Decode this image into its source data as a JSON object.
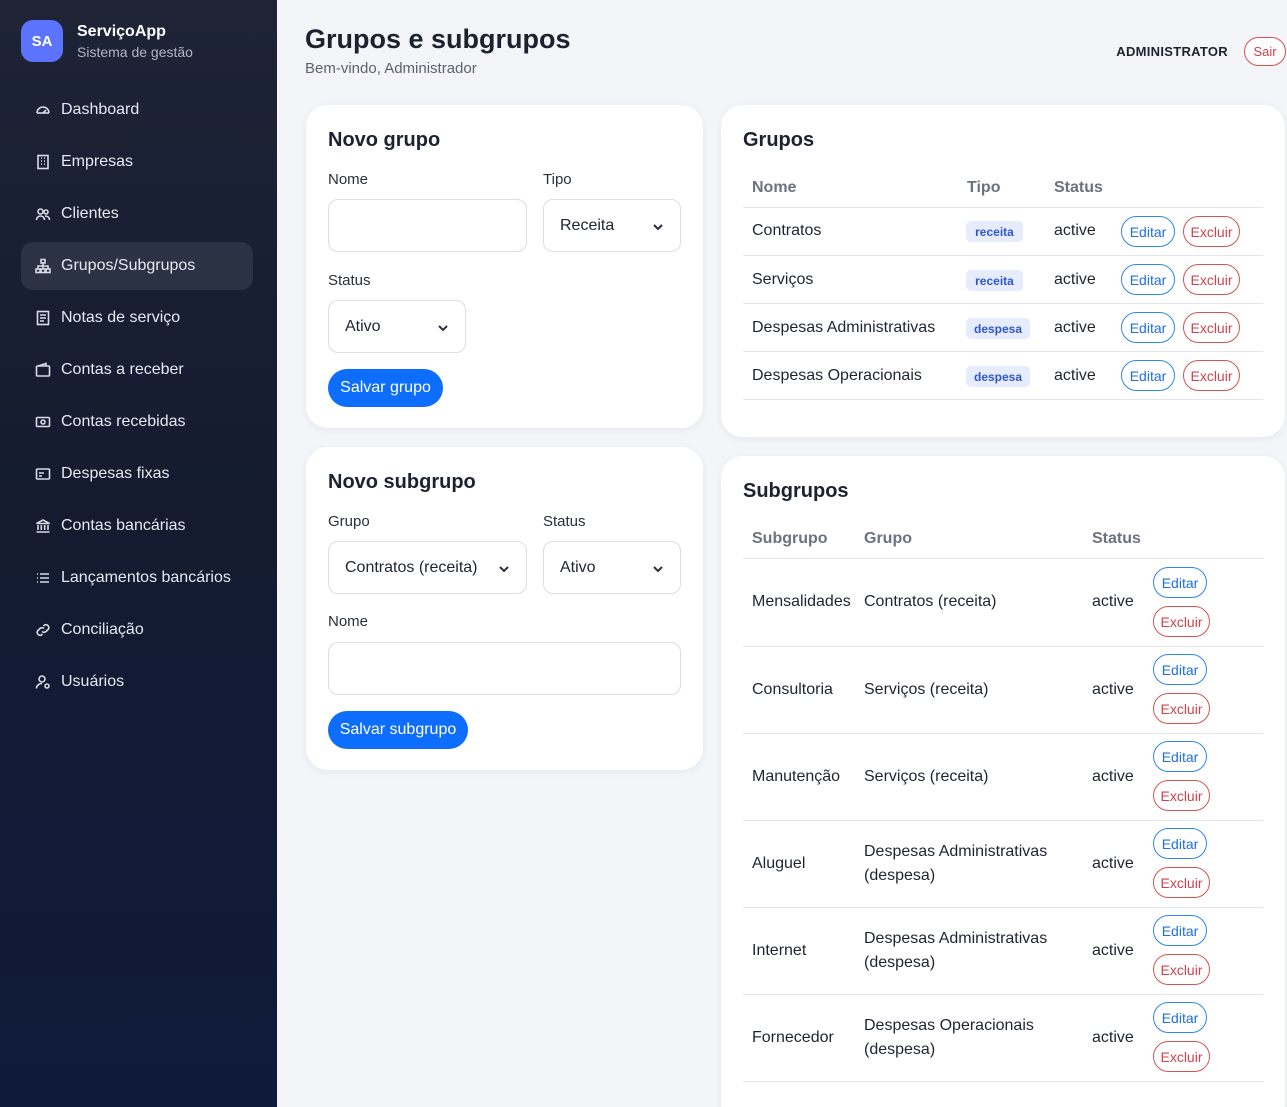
{
  "brand": {
    "initials": "SA",
    "name": "ServiçoApp",
    "subtitle": "Sistema de gestão"
  },
  "sidebar": {
    "items": [
      {
        "label": "Dashboard",
        "icon": "dashboard-icon"
      },
      {
        "label": "Empresas",
        "icon": "building-icon"
      },
      {
        "label": "Clientes",
        "icon": "users-icon"
      },
      {
        "label": "Grupos/Subgrupos",
        "icon": "hierarchy-icon",
        "active": true
      },
      {
        "label": "Notas de serviço",
        "icon": "document-icon"
      },
      {
        "label": "Contas a receber",
        "icon": "wallet-icon"
      },
      {
        "label": "Contas recebidas",
        "icon": "cash-icon"
      },
      {
        "label": "Despesas fixas",
        "icon": "card-icon"
      },
      {
        "label": "Contas bancárias",
        "icon": "bank-icon"
      },
      {
        "label": "Lançamentos bancários",
        "icon": "list-icon"
      },
      {
        "label": "Conciliação",
        "icon": "link-icon"
      },
      {
        "label": "Usuários",
        "icon": "user-gear-icon"
      }
    ]
  },
  "header": {
    "title": "Grupos e subgrupos",
    "subtitle": "Bem-vindo, Administrador",
    "role": "ADMINISTRATOR",
    "logout": "Sair"
  },
  "novo_grupo": {
    "title": "Novo grupo",
    "nome_label": "Nome",
    "nome_value": "",
    "tipo_label": "Tipo",
    "tipo_value": "Receita",
    "status_label": "Status",
    "status_value": "Ativo",
    "save": "Salvar grupo"
  },
  "novo_subgrupo": {
    "title": "Novo subgrupo",
    "grupo_label": "Grupo",
    "grupo_value": "Contratos (receita)",
    "status_label": "Status",
    "status_value": "Ativo",
    "nome_label": "Nome",
    "nome_value": "",
    "save": "Salvar subgrupo"
  },
  "grupos": {
    "title": "Grupos",
    "headers": {
      "nome": "Nome",
      "tipo": "Tipo",
      "status": "Status"
    },
    "rows": [
      {
        "nome": "Contratos",
        "tipo": "receita",
        "status": "active"
      },
      {
        "nome": "Serviços",
        "tipo": "receita",
        "status": "active"
      },
      {
        "nome": "Despesas Administrativas",
        "tipo": "despesa",
        "status": "active"
      },
      {
        "nome": "Despesas Operacionais",
        "tipo": "despesa",
        "status": "active"
      }
    ]
  },
  "subgrupos": {
    "title": "Subgrupos",
    "headers": {
      "subgrupo": "Subgrupo",
      "grupo": "Grupo",
      "status": "Status"
    },
    "rows": [
      {
        "subgrupo": "Mensalidades",
        "grupo1": "Contratos (receita)",
        "grupo2": "",
        "status": "active"
      },
      {
        "subgrupo": "Consultoria",
        "grupo1": "Serviços (receita)",
        "grupo2": "",
        "status": "active"
      },
      {
        "subgrupo": "Manutenção",
        "grupo1": "Serviços (receita)",
        "grupo2": "",
        "status": "active"
      },
      {
        "subgrupo": "Aluguel",
        "grupo1": "Despesas Administrativas",
        "grupo2": "(despesa)",
        "status": "active"
      },
      {
        "subgrupo": "Internet",
        "grupo1": "Despesas Administrativas",
        "grupo2": "(despesa)",
        "status": "active"
      },
      {
        "subgrupo": "Fornecedor",
        "grupo1": "Despesas Operacionais",
        "grupo2": "(despesa)",
        "status": "active"
      }
    ]
  },
  "actions": {
    "edit": "Editar",
    "delete": "Excluir"
  },
  "colors": {
    "primary": "#0d6efd",
    "danger": "#d9534f",
    "sidebar_bg": "#141b30",
    "accent": "#5b73ff"
  }
}
